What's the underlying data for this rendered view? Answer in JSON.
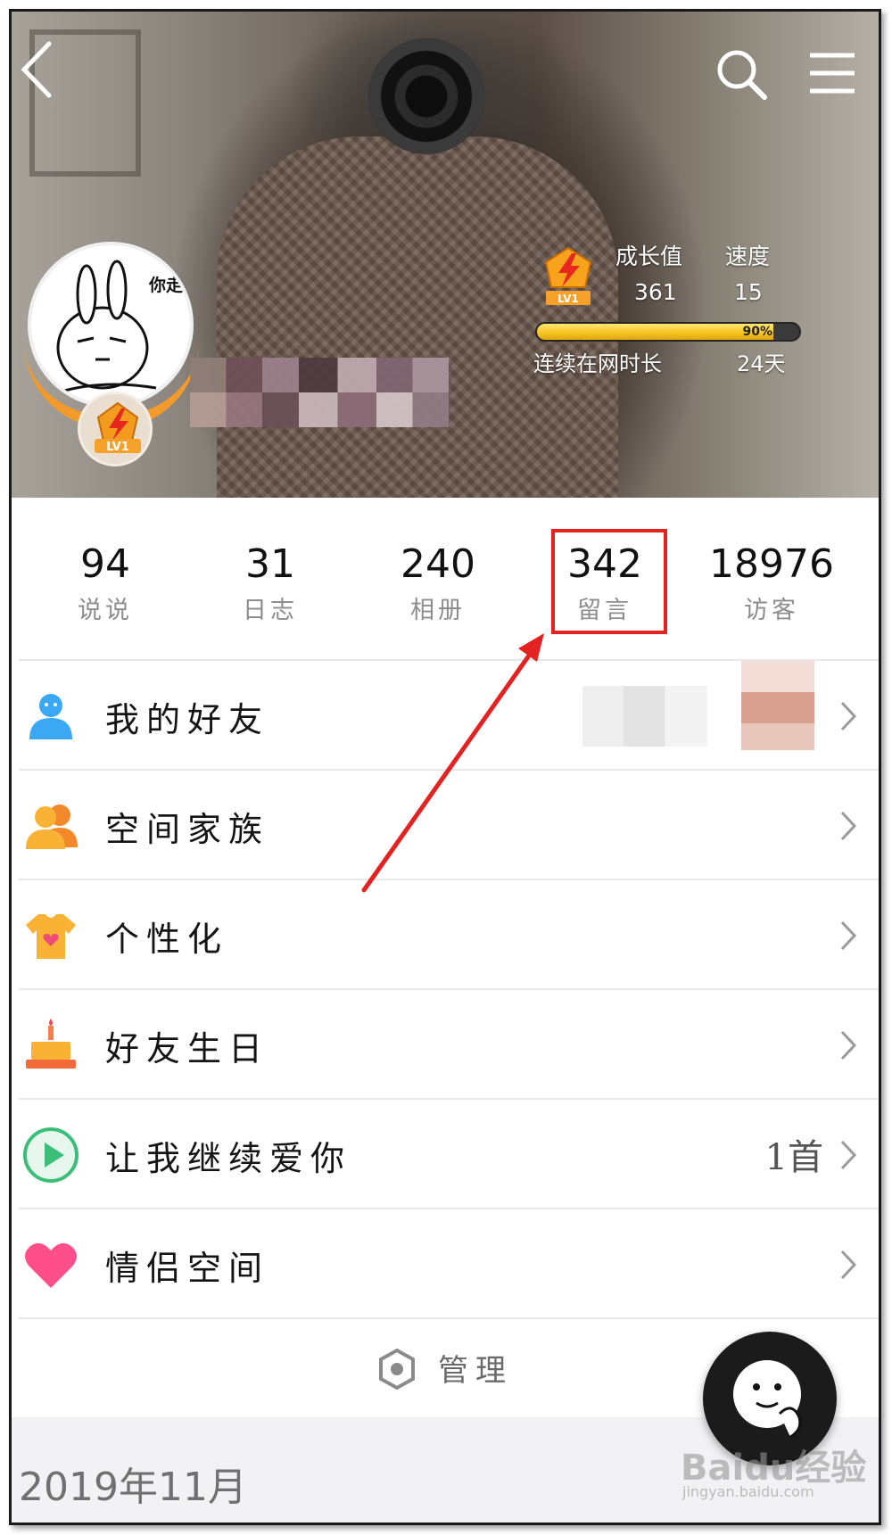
{
  "header": {
    "avatar_caption": "你走",
    "level_badge": "LV1",
    "growth_label": "成长值",
    "speed_label": "速度",
    "growth_value": "361",
    "speed_value": "15",
    "progress_percent_text": "90%",
    "progress_fraction": 0.9,
    "online_label": "连续在网时长",
    "online_value": "24天"
  },
  "stats": [
    {
      "value": "94",
      "label": "说说"
    },
    {
      "value": "31",
      "label": "日志"
    },
    {
      "value": "240",
      "label": "相册"
    },
    {
      "value": "342",
      "label": "留言"
    },
    {
      "value": "18976",
      "label": "访客"
    }
  ],
  "menu": [
    {
      "label": "我的好友",
      "icon": "friend-icon",
      "extra": ""
    },
    {
      "label": "空间家族",
      "icon": "family-icon",
      "extra": ""
    },
    {
      "label": "个性化",
      "icon": "tshirt-icon",
      "extra": ""
    },
    {
      "label": "好友生日",
      "icon": "cake-icon",
      "extra": ""
    },
    {
      "label": "让我继续爱你",
      "icon": "play-icon",
      "extra": "1首"
    },
    {
      "label": "情侣空间",
      "icon": "heart-icon",
      "extra": ""
    }
  ],
  "manage": {
    "label": "管理"
  },
  "date_section": {
    "label": "2019年11月"
  },
  "watermark": {
    "brand": "Baidu经验",
    "url": "jingyan.baidu.com"
  },
  "colors": {
    "highlight": "#e32222",
    "accent_orange": "#f39a2c",
    "progress_yellow": "#f5c524",
    "friend_blue": "#3aa8f2",
    "family_orange": "#f7a92b",
    "play_green": "#3bbf78",
    "heart_pink": "#ff4f8b"
  }
}
